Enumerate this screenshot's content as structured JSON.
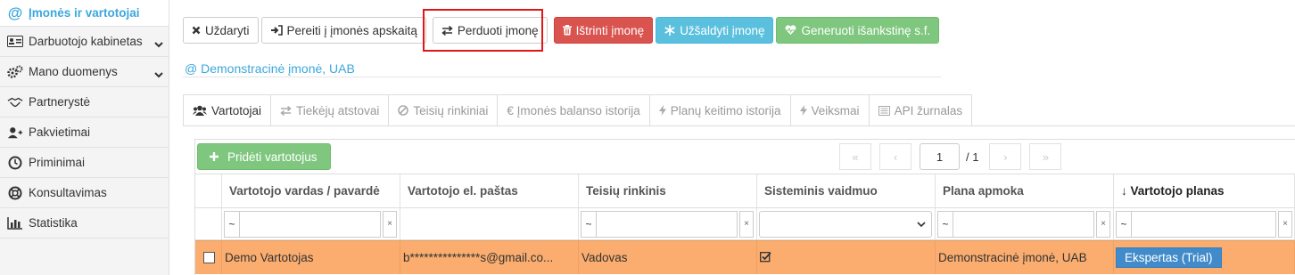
{
  "sidebar": {
    "items": [
      {
        "label": "Įmonės ir vartotojai",
        "icon": "at-icon",
        "active": true,
        "chevron": false
      },
      {
        "label": "Darbuotojo kabinetas",
        "icon": "id-card-icon",
        "chevron": true
      },
      {
        "label": "Mano duomenys",
        "icon": "gears-icon",
        "chevron": true
      },
      {
        "label": "Partnerystė",
        "icon": "handshake-icon",
        "chevron": false
      },
      {
        "label": "Pakvietimai",
        "icon": "user-plus-icon",
        "chevron": false
      },
      {
        "label": "Priminimai",
        "icon": "clock-icon",
        "chevron": false
      },
      {
        "label": "Konsultavimas",
        "icon": "lifebuoy-icon",
        "chevron": false
      },
      {
        "label": "Statistika",
        "icon": "bar-chart-icon",
        "chevron": false
      }
    ]
  },
  "toolbar": {
    "close_label": "Uždaryti",
    "goto_label": "Pereiti į įmonės apskaitą",
    "transfer_label": "Perduoti įmonę",
    "delete_label": "Ištrinti įmonę",
    "freeze_label": "Užšaldyti įmonę",
    "invoice_label": "Generuoti išankstinę s.f."
  },
  "company": {
    "name": "Demonstracinė įmonė, UAB"
  },
  "tabs": [
    {
      "label": "Vartotojai",
      "icon": "users-icon",
      "active": true
    },
    {
      "label": "Tiekėjų atstovai",
      "icon": "exchange-icon"
    },
    {
      "label": "Teisių rinkiniai",
      "icon": "ban-icon"
    },
    {
      "label": "€ Įmonės balanso istorija",
      "icon": ""
    },
    {
      "label": "Planų keitimo istorija",
      "icon": "bolt-icon"
    },
    {
      "label": "Veiksmai",
      "icon": "bolt-icon"
    },
    {
      "label": "API žurnalas",
      "icon": "list-icon"
    }
  ],
  "panel": {
    "add_label": "Pridėti vartotojus",
    "pager": {
      "page": "1",
      "total": "/ 1"
    }
  },
  "table": {
    "headers": [
      "Vartotojo vardas / pavardė",
      "Vartotojo el. paštas",
      "Teisių rinkinis",
      "Sisteminis vaidmuo",
      "Plana apmoka",
      "↓ Vartotojo planas"
    ],
    "filter_op": "~",
    "filter_clear": "×",
    "rows": [
      {
        "name": "Demo Vartotojas",
        "email": "b***************s@gmail.co...",
        "rights": "Vadovas",
        "system_role_checked": true,
        "payer": "Demonstracinė įmonė, UAB",
        "plan": "Ekspertas (Trial)"
      }
    ]
  },
  "colors": {
    "accent": "#3ca7dc",
    "highlight": "#e0161b",
    "row_selected": "#fbad6f",
    "badge": "#428bca"
  }
}
